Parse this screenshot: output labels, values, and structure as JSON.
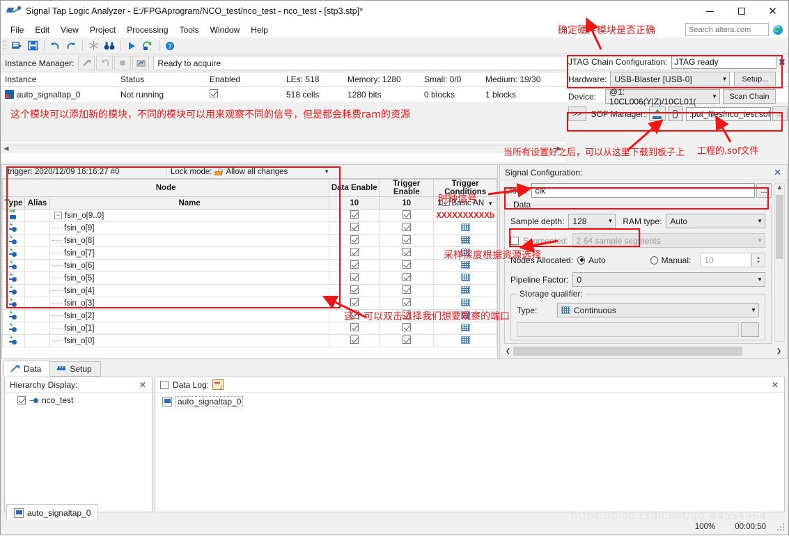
{
  "window": {
    "title": "Signal Tap Logic Analyzer - E:/FPGAprogram/NCO_test/nco_test - nco_test - [stp3.stp]*",
    "minimize": "—",
    "maximize": "□",
    "close": "✕"
  },
  "menu": {
    "items": [
      "File",
      "Edit",
      "View",
      "Project",
      "Processing",
      "Tools",
      "Window",
      "Help"
    ]
  },
  "search": {
    "placeholder": "Search altera.com",
    "value": ""
  },
  "instance_manager": {
    "label": "Instance Manager:",
    "status": "Ready to acquire",
    "close": "✕",
    "columns": [
      "Instance",
      "Status",
      "Enabled",
      "LEs: 518",
      "Memory: 1280",
      "Small: 0/0",
      "Medium: 19/30"
    ],
    "rows": [
      {
        "instance": "auto_signaltap_0",
        "status": "Not running",
        "enabled": true,
        "les": "518 cells",
        "memory": "1280 bits",
        "small": "0 blocks",
        "medium": "1 blocks"
      }
    ]
  },
  "jtag": {
    "chain_label": "JTAG Chain Configuration:",
    "chain_status": "JTAG ready",
    "close": "✕",
    "hardware_label": "Hardware:",
    "hardware_value": "USB-Blaster [USB-0]",
    "setup_button": "Setup...",
    "device_label": "Device:",
    "device_value": "@1: 10CL006(Y|Z)/10CL01(",
    "scan_chain_button": "Scan Chain",
    "expand_button": ">>",
    "sof_label": "SOF Manager:",
    "sof_path": ":put_files/nco_test.sof",
    "sof_browse": "..."
  },
  "node_table": {
    "trigger_label": "trigger: 2020/12/09 16:16:27  #0",
    "lock_mode_label": "Lock mode:",
    "lock_mode_value": "Allow all changes",
    "group_header": "Node",
    "headers": [
      "Type",
      "Alias",
      "Name",
      "Data Enable",
      "Trigger Enable",
      "Trigger Conditions"
    ],
    "count_row": {
      "data_enable": "10",
      "trigger_enable": "10",
      "trigger_conditions": "1",
      "trigger_type": "Basic AN"
    },
    "rows": [
      {
        "name": "fsin_o[9..0]",
        "group": true,
        "data_enable": true,
        "trigger_enable": true,
        "condition": "XXXXXXXXXXb"
      },
      {
        "name": "fsin_o[9]",
        "group": false,
        "data_enable": true,
        "trigger_enable": true,
        "condition": ""
      },
      {
        "name": "fsin_o[8]",
        "group": false,
        "data_enable": true,
        "trigger_enable": true,
        "condition": ""
      },
      {
        "name": "fsin_o[7]",
        "group": false,
        "data_enable": true,
        "trigger_enable": true,
        "condition": ""
      },
      {
        "name": "fsin_o[6]",
        "group": false,
        "data_enable": true,
        "trigger_enable": true,
        "condition": ""
      },
      {
        "name": "fsin_o[5]",
        "group": false,
        "data_enable": true,
        "trigger_enable": true,
        "condition": ""
      },
      {
        "name": "fsin_o[4]",
        "group": false,
        "data_enable": true,
        "trigger_enable": true,
        "condition": ""
      },
      {
        "name": "fsin_o[3]",
        "group": false,
        "data_enable": true,
        "trigger_enable": true,
        "condition": ""
      },
      {
        "name": "fsin_o[2]",
        "group": false,
        "data_enable": true,
        "trigger_enable": true,
        "condition": ""
      },
      {
        "name": "fsin_o[1]",
        "group": false,
        "data_enable": true,
        "trigger_enable": true,
        "condition": ""
      },
      {
        "name": "fsin_o[0]",
        "group": false,
        "data_enable": true,
        "trigger_enable": true,
        "condition": ""
      }
    ]
  },
  "signal_config": {
    "title": "Signal Configuration:",
    "close": "✕",
    "clock_label": "Clock:",
    "clock_value": "clk",
    "clock_browse": "...",
    "data_group": "Data",
    "sample_depth_label": "Sample depth:",
    "sample_depth_value": "128",
    "ram_type_label": "RAM type:",
    "ram_type_value": "Auto",
    "segmented_label": "Segmented:",
    "segmented_value": "2  64 sample segments",
    "segmented_checked": false,
    "nodes_allocated_label": "Nodes Allocated:",
    "nodes_auto_label": "Auto",
    "nodes_manual_label": "Manual:",
    "nodes_manual_value": "10",
    "nodes_mode": "Auto",
    "pipeline_label": "Pipeline Factor:",
    "pipeline_value": "0",
    "storage_group": "Storage qualifier:",
    "type_label": "Type:",
    "type_value": "Continuous"
  },
  "tabs": {
    "items": [
      {
        "label": "Data",
        "active": true
      },
      {
        "label": "Setup",
        "active": false
      }
    ]
  },
  "hierarchy": {
    "title": "Hierarchy Display:",
    "close": "✕",
    "items": [
      {
        "label": "nco_test",
        "checked": true
      }
    ]
  },
  "data_log": {
    "title": "Data Log:",
    "checked": false,
    "close": "✕",
    "items": [
      {
        "label": "auto_signaltap_0"
      }
    ]
  },
  "bottom_tab": {
    "label": "auto_signaltap_0"
  },
  "status_bar": {
    "zoom": "100%",
    "time": "00:00:50"
  },
  "watermark": {
    "text": "https://blog.csdn.net/qq_44554964"
  },
  "annotations": [
    {
      "id": "anno-hardware",
      "text": "确定硬件模块是否正确"
    },
    {
      "id": "anno-modules",
      "text": "这个模块可以添加新的模块，不同的模块可以用来观察不同的信号，但是都会耗费ram的资源"
    },
    {
      "id": "anno-download",
      "text": "当所有设置好之后，可以从这里下载到板子上"
    },
    {
      "id": "anno-soffile",
      "text": "工程的.sof文件"
    },
    {
      "id": "anno-clock",
      "text": "时钟信号"
    },
    {
      "id": "anno-depth",
      "text": "采样深度根据资源选择"
    },
    {
      "id": "anno-ports",
      "text": "这个可以双击选择我们想要观察的端口"
    }
  ]
}
